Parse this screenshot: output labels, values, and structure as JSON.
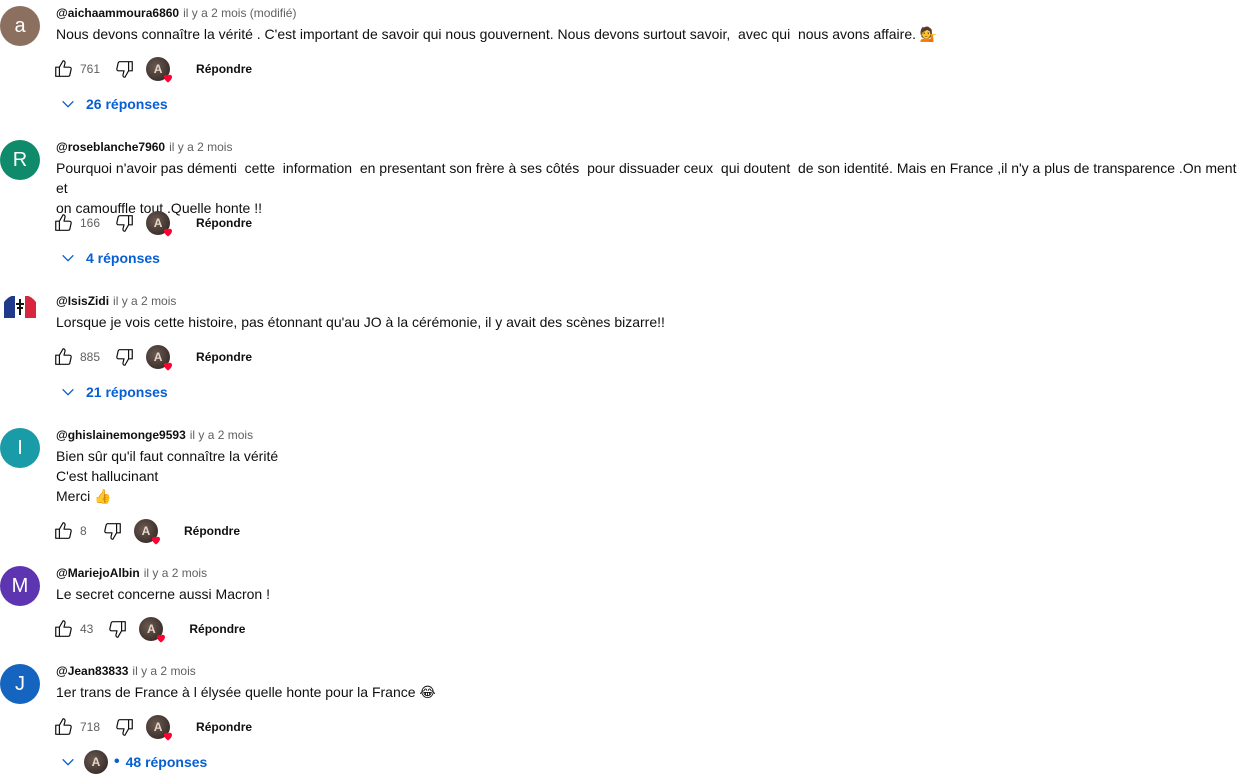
{
  "colors": {
    "link": "#065fd4",
    "meta": "#606060"
  },
  "comments": [
    {
      "avatar_letter": "a",
      "avatar_color": "#8b6f5f",
      "author": "@aichaammoura6860",
      "time": "il y a 2 mois (modifié)",
      "lines": [
        "Nous devons connaître la vérité . C'est important de savoir qui nous gouvernent. Nous devons surtout savoir,  avec qui  nous avons affaire. 💁"
      ],
      "likes": "761",
      "reply_label": "Répondre",
      "replies": "26 réponses"
    },
    {
      "avatar_letter": "R",
      "avatar_color": "#0f8a6b",
      "author": "@roseblanche7960",
      "time": "il y a 2 mois",
      "lines": [
        "Pourquoi n'avoir pas démenti  cette  information  en presentant son frère à ses côtés  pour dissuader ceux  qui doutent  de son identité. Mais en France ,il n'y a plus de transparence .On ment et",
        "on camouffle tout .Quelle honte !!"
      ],
      "likes": "166",
      "reply_label": "Répondre",
      "replies": "4 réponses"
    },
    {
      "avatar_letter": "",
      "avatar_color": "#ffffff",
      "avatar_icon": "french-flag-icon",
      "author": "@IsisZidi",
      "time": "il y a 2 mois",
      "lines": [
        "Lorsque je vois cette histoire, pas étonnant qu'au JO à la cérémonie, il y avait des scènes bizarre!!"
      ],
      "likes": "885",
      "reply_label": "Répondre",
      "replies": "21 réponses"
    },
    {
      "avatar_letter": "I",
      "avatar_color": "#1a9ba8",
      "author": "@ghislainemonge9593",
      "time": "il y a 2 mois",
      "lines": [
        "Bien sûr qu'il faut connaître la vérité",
        "C'est hallucinant",
        "Merci 👍"
      ],
      "likes": "8",
      "reply_label": "Répondre"
    },
    {
      "avatar_letter": "M",
      "avatar_color": "#5e35b1",
      "author": "@MariejoAlbin",
      "time": "il y a 2 mois",
      "lines": [
        "Le secret concerne aussi Macron !"
      ],
      "likes": "43",
      "reply_label": "Répondre"
    },
    {
      "avatar_letter": "J",
      "avatar_color": "#1565c0",
      "author": "@Jean83833",
      "time": "il y a 2 mois",
      "lines": [
        "1er trans de France à l élysée quelle honte pour la France 😂"
      ],
      "likes": "718",
      "reply_label": "Répondre",
      "replies": "48 réponses"
    }
  ],
  "creator_avatar_letter": "A"
}
